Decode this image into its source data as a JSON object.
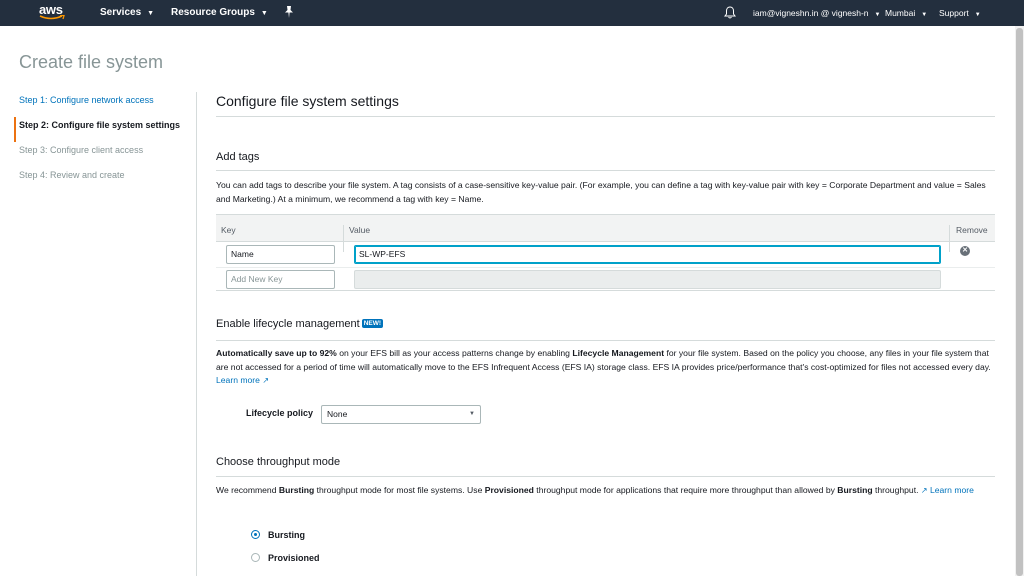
{
  "nav": {
    "logo_text": "aws",
    "services": "Services",
    "resource_groups": "Resource Groups",
    "account": "iam@vigneshn.in @ vignesh-n",
    "region": "Mumbai",
    "support": "Support"
  },
  "page": {
    "title": "Create file system"
  },
  "steps": [
    {
      "label": "Step 1: Configure network access",
      "state": "link"
    },
    {
      "label": "Step 2: Configure file system settings",
      "state": "active"
    },
    {
      "label": "Step 3: Configure client access",
      "state": "disabled"
    },
    {
      "label": "Step 4: Review and create",
      "state": "disabled"
    }
  ],
  "main": {
    "heading": "Configure file system settings",
    "tags": {
      "heading": "Add tags",
      "description": "You can add tags to describe your file system. A tag consists of a case-sensitive key-value pair. (For example, you can define a tag with key-value pair with key = Corporate Department and value = Sales and Marketing.) At a minimum, we recommend a tag with key = Name.",
      "col_key": "Key",
      "col_value": "Value",
      "col_remove": "Remove",
      "row1_key": "Name",
      "row1_value": "SL-WP-EFS",
      "new_key_placeholder": "Add New Key"
    },
    "lifecycle": {
      "heading": "Enable lifecycle management",
      "badge": "NEW!",
      "text_bold1": "Automatically save up to 92%",
      "text1": " on your EFS bill as your access patterns change by enabling ",
      "text_bold2": "Lifecycle Management",
      "text2": " for your file system. Based on the policy you choose, any files in your file system that are not accessed for a period of time will automatically move to the EFS Infrequent Access (EFS IA) storage class. EFS IA provides price/performance that's cost-optimized for files not accessed every day. ",
      "learn_more": "Learn more",
      "policy_label": "Lifecycle policy",
      "policy_value": "None"
    },
    "throughput": {
      "heading": "Choose throughput mode",
      "t1": "We recommend ",
      "b1": "Bursting",
      "t2": " throughput mode for most file systems. Use ",
      "b2": "Provisioned",
      "t3": " throughput mode for applications that require more throughput than allowed by ",
      "b3": "Bursting",
      "t4": " throughput. ",
      "learn_more": "Learn more",
      "options": [
        "Bursting",
        "Provisioned"
      ],
      "selected": "Bursting"
    }
  }
}
